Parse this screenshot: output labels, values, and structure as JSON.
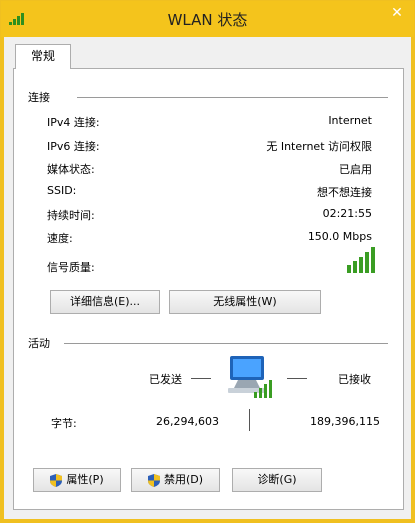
{
  "window": {
    "title": "WLAN 状态",
    "close_label": "✕"
  },
  "tabs": [
    {
      "label": "常规"
    }
  ],
  "connection": {
    "group_title": "连接",
    "rows": [
      {
        "label": "IPv4 连接:",
        "value": "Internet"
      },
      {
        "label": "IPv6 连接:",
        "value": "无 Internet 访问权限"
      },
      {
        "label": "媒体状态:",
        "value": "已启用"
      },
      {
        "label": "SSID:",
        "value": "想不想连接"
      },
      {
        "label": "持续时间:",
        "value": "02:21:55"
      },
      {
        "label": "速度:",
        "value": "150.0 Mbps"
      }
    ],
    "signal_label": "信号质量:",
    "signal_bars": 5,
    "details_button": "详细信息(E)...",
    "wireless_props_button": "无线属性(W)"
  },
  "activity": {
    "group_title": "活动",
    "sent_label": "已发送",
    "received_label": "已接收",
    "bytes_label": "字节:",
    "bytes_sent": "26,294,603",
    "bytes_received": "189,396,115"
  },
  "buttons": {
    "properties": "属性(P)",
    "disable": "禁用(D)",
    "diagnose": "诊断(G)"
  },
  "icons": {
    "title": "wifi-signal-icon",
    "network": "network-computer-icon",
    "shield": "uac-shield-icon"
  },
  "colors": {
    "titlebar": "#f4c41c",
    "signal": "#3a9d23"
  }
}
